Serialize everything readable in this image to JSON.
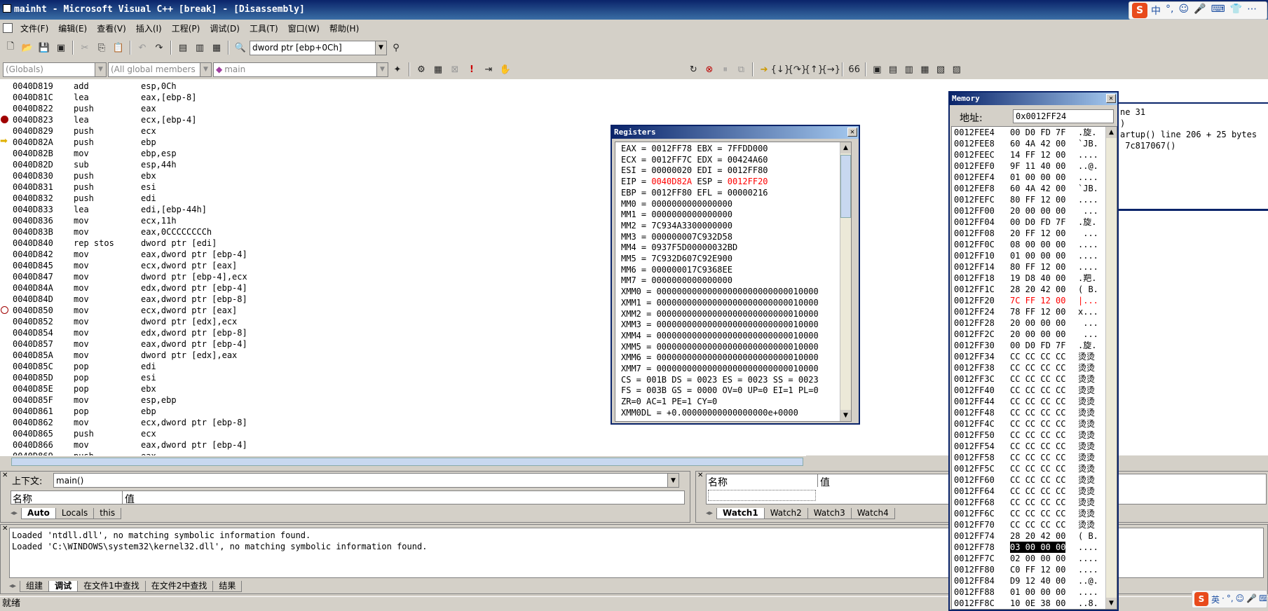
{
  "title": "mainht - Microsoft Visual C++ [break] - [Disassembly]",
  "ime_top": {
    "logo": "S",
    "items": [
      "中",
      "°,",
      "☺",
      "🎤",
      "⌨",
      "👕",
      "⋯"
    ]
  },
  "menu": [
    "文件(F)",
    "编辑(E)",
    "查看(V)",
    "插入(I)",
    "工程(P)",
    "调试(D)",
    "工具(T)",
    "窗口(W)",
    "帮助(H)"
  ],
  "find_combo": "dword ptr [ebp+0Ch]",
  "scope_combos": [
    "(Globals)",
    "(All global members",
    "main"
  ],
  "disasm": [
    {
      "addr": "0040D819",
      "op": "add",
      "arg": "esp,0Ch"
    },
    {
      "addr": "0040D81C",
      "op": "lea",
      "arg": "eax,[ebp-8]"
    },
    {
      "addr": "0040D822",
      "op": "push",
      "arg": "eax"
    },
    {
      "addr": "0040D823",
      "op": "lea",
      "arg": "ecx,[ebp-4]",
      "marker": "breakpoint"
    },
    {
      "addr": "0040D829",
      "op": "push",
      "arg": "ecx"
    },
    {
      "addr": "0040D82A",
      "op": "push",
      "arg": "ebp",
      "marker": "current"
    },
    {
      "addr": "0040D82B",
      "op": "mov",
      "arg": "ebp,esp"
    },
    {
      "addr": "0040D82D",
      "op": "sub",
      "arg": "esp,44h"
    },
    {
      "addr": "0040D830",
      "op": "push",
      "arg": "ebx"
    },
    {
      "addr": "0040D831",
      "op": "push",
      "arg": "esi"
    },
    {
      "addr": "0040D832",
      "op": "push",
      "arg": "edi"
    },
    {
      "addr": "0040D833",
      "op": "lea",
      "arg": "edi,[ebp-44h]"
    },
    {
      "addr": "0040D836",
      "op": "mov",
      "arg": "ecx,11h"
    },
    {
      "addr": "0040D83B",
      "op": "mov",
      "arg": "eax,0CCCCCCCCh"
    },
    {
      "addr": "0040D840",
      "op": "rep stos",
      "arg": "dword ptr [edi]"
    },
    {
      "addr": "0040D842",
      "op": "mov",
      "arg": "eax,dword ptr [ebp-4]"
    },
    {
      "addr": "0040D845",
      "op": "mov",
      "arg": "ecx,dword ptr [eax]"
    },
    {
      "addr": "0040D847",
      "op": "mov",
      "arg": "dword ptr [ebp-4],ecx"
    },
    {
      "addr": "0040D84A",
      "op": "mov",
      "arg": "edx,dword ptr [ebp-4]"
    },
    {
      "addr": "0040D84D",
      "op": "mov",
      "arg": "eax,dword ptr [ebp-8]"
    },
    {
      "addr": "0040D850",
      "op": "mov",
      "arg": "ecx,dword ptr [eax]",
      "marker": "disabled"
    },
    {
      "addr": "0040D852",
      "op": "mov",
      "arg": "dword ptr [edx],ecx"
    },
    {
      "addr": "0040D854",
      "op": "mov",
      "arg": "edx,dword ptr [ebp-8]"
    },
    {
      "addr": "0040D857",
      "op": "mov",
      "arg": "eax,dword ptr [ebp-4]"
    },
    {
      "addr": "0040D85A",
      "op": "mov",
      "arg": "dword ptr [edx],eax"
    },
    {
      "addr": "0040D85C",
      "op": "pop",
      "arg": "edi"
    },
    {
      "addr": "0040D85D",
      "op": "pop",
      "arg": "esi"
    },
    {
      "addr": "0040D85E",
      "op": "pop",
      "arg": "ebx"
    },
    {
      "addr": "0040D85F",
      "op": "mov",
      "arg": "esp,ebp"
    },
    {
      "addr": "0040D861",
      "op": "pop",
      "arg": "ebp"
    },
    {
      "addr": "0040D862",
      "op": "mov",
      "arg": "ecx,dword ptr [ebp-8]"
    },
    {
      "addr": "0040D865",
      "op": "push",
      "arg": "ecx"
    },
    {
      "addr": "0040D866",
      "op": "mov",
      "arg": "eax,dword ptr [ebp-4]"
    },
    {
      "addr": "0040D869",
      "op": "push",
      "arg": "eax"
    }
  ],
  "callstack_partial": [
    "ne 31",
    ")",
    "artup() line 206 + 25 bytes",
    " 7c817067()"
  ],
  "registers": {
    "title": "Registers",
    "lines": [
      {
        "text": "EAX = 0012FF78 EBX = 7FFDD000"
      },
      {
        "text": "ECX = 0012FF7C EDX = 00424A60"
      },
      {
        "text": "ESI = 00000020 EDI = 0012FF80"
      },
      {
        "parts": [
          "EIP = ",
          "0040D82A",
          " ESP = ",
          "0012FF20"
        ],
        "red": [
          1,
          3
        ]
      },
      {
        "text": "EBP = 0012FF80 EFL = 00000216"
      },
      {
        "text": "MM0 = 0000000000000000"
      },
      {
        "text": "MM1 = 0000000000000000"
      },
      {
        "text": "MM2 = 7C934A3300000000"
      },
      {
        "text": "MM3 = 000000007C932D58"
      },
      {
        "text": "MM4 = 0937F5D00000032BD"
      },
      {
        "text": "MM5 = 7C932D607C92E900"
      },
      {
        "text": "MM6 = 000000017C9368EE"
      },
      {
        "text": "MM7 = 0000000000000000"
      },
      {
        "text": "XMM0 = 00000000000000000000000000010000"
      },
      {
        "text": "XMM1 = 00000000000000000000000000010000"
      },
      {
        "text": "XMM2 = 00000000000000000000000000010000"
      },
      {
        "text": "XMM3 = 00000000000000000000000000010000"
      },
      {
        "text": "XMM4 = 00000000000000000000000000010000"
      },
      {
        "text": "XMM5 = 00000000000000000000000000010000"
      },
      {
        "text": "XMM6 = 00000000000000000000000000010000"
      },
      {
        "text": "XMM7 = 00000000000000000000000000010000"
      },
      {
        "text": "CS = 001B DS = 0023 ES = 0023 SS = 0023"
      },
      {
        "text": "FS = 003B GS = 0000 OV=0 UP=0 EI=1 PL=0"
      },
      {
        "text": "ZR=0 AC=1 PE=1 CY=0"
      },
      {
        "text": "XMM0DL = +0.00000000000000000e+0000"
      }
    ]
  },
  "memory": {
    "title": "Memory",
    "address_label": "地址:",
    "address_value": "0x0012FF24",
    "rows": [
      {
        "addr": "0012FEE4",
        "bytes": "00 D0 FD 7F",
        "ascii": ".旋."
      },
      {
        "addr": "0012FEE8",
        "bytes": "60 4A 42 00",
        "ascii": "`JB."
      },
      {
        "addr": "0012FEEC",
        "bytes": "14 FF 12 00",
        "ascii": "...."
      },
      {
        "addr": "0012FEF0",
        "bytes": "9F 11 40 00",
        "ascii": "..@."
      },
      {
        "addr": "0012FEF4",
        "bytes": "01 00 00 00",
        "ascii": "...."
      },
      {
        "addr": "0012FEF8",
        "bytes": "60 4A 42 00",
        "ascii": "`JB."
      },
      {
        "addr": "0012FEFC",
        "bytes": "80 FF 12 00",
        "ascii": "...."
      },
      {
        "addr": "0012FF00",
        "bytes": "20 00 00 00",
        "ascii": " ..."
      },
      {
        "addr": "0012FF04",
        "bytes": "00 D0 FD 7F",
        "ascii": ".旋."
      },
      {
        "addr": "0012FF08",
        "bytes": "20 FF 12 00",
        "ascii": " ..."
      },
      {
        "addr": "0012FF0C",
        "bytes": "08 00 00 00",
        "ascii": "...."
      },
      {
        "addr": "0012FF10",
        "bytes": "01 00 00 00",
        "ascii": "...."
      },
      {
        "addr": "0012FF14",
        "bytes": "80 FF 12 00",
        "ascii": "...."
      },
      {
        "addr": "0012FF18",
        "bytes": "19 D8 40 00",
        "ascii": ".羓."
      },
      {
        "addr": "0012FF1C",
        "bytes": "28 20 42 00",
        "ascii": "( B."
      },
      {
        "addr": "0012FF20",
        "bytes": "7C FF 12 00",
        "ascii": "|...",
        "red": true
      },
      {
        "addr": "0012FF24",
        "bytes": "78 FF 12 00",
        "ascii": "x..."
      },
      {
        "addr": "0012FF28",
        "bytes": "20 00 00 00",
        "ascii": " ..."
      },
      {
        "addr": "0012FF2C",
        "bytes": "20 00 00 00",
        "ascii": " ..."
      },
      {
        "addr": "0012FF30",
        "bytes": "00 D0 FD 7F",
        "ascii": ".旋."
      },
      {
        "addr": "0012FF34",
        "bytes": "CC CC CC CC",
        "ascii": "烫烫"
      },
      {
        "addr": "0012FF38",
        "bytes": "CC CC CC CC",
        "ascii": "烫烫"
      },
      {
        "addr": "0012FF3C",
        "bytes": "CC CC CC CC",
        "ascii": "烫烫"
      },
      {
        "addr": "0012FF40",
        "bytes": "CC CC CC CC",
        "ascii": "烫烫"
      },
      {
        "addr": "0012FF44",
        "bytes": "CC CC CC CC",
        "ascii": "烫烫"
      },
      {
        "addr": "0012FF48",
        "bytes": "CC CC CC CC",
        "ascii": "烫烫"
      },
      {
        "addr": "0012FF4C",
        "bytes": "CC CC CC CC",
        "ascii": "烫烫"
      },
      {
        "addr": "0012FF50",
        "bytes": "CC CC CC CC",
        "ascii": "烫烫"
      },
      {
        "addr": "0012FF54",
        "bytes": "CC CC CC CC",
        "ascii": "烫烫"
      },
      {
        "addr": "0012FF58",
        "bytes": "CC CC CC CC",
        "ascii": "烫烫"
      },
      {
        "addr": "0012FF5C",
        "bytes": "CC CC CC CC",
        "ascii": "烫烫"
      },
      {
        "addr": "0012FF60",
        "bytes": "CC CC CC CC",
        "ascii": "烫烫"
      },
      {
        "addr": "0012FF64",
        "bytes": "CC CC CC CC",
        "ascii": "烫烫"
      },
      {
        "addr": "0012FF68",
        "bytes": "CC CC CC CC",
        "ascii": "烫烫"
      },
      {
        "addr": "0012FF6C",
        "bytes": "CC CC CC CC",
        "ascii": "烫烫"
      },
      {
        "addr": "0012FF70",
        "bytes": "CC CC CC CC",
        "ascii": "烫烫"
      },
      {
        "addr": "0012FF74",
        "bytes": "28 20 42 00",
        "ascii": "( B."
      },
      {
        "addr": "0012FF78",
        "bytes": "03 00 00 00",
        "ascii": "....",
        "selected": true
      },
      {
        "addr": "0012FF7C",
        "bytes": "02 00 00 00",
        "ascii": "...."
      },
      {
        "addr": "0012FF80",
        "bytes": "C0 FF 12 00",
        "ascii": "...."
      },
      {
        "addr": "0012FF84",
        "bytes": "D9 12 40 00",
        "ascii": "..@."
      },
      {
        "addr": "0012FF88",
        "bytes": "01 00 00 00",
        "ascii": "...."
      },
      {
        "addr": "0012FF8C",
        "bytes": "10 0E 38 00",
        "ascii": "..8."
      }
    ]
  },
  "variables": {
    "context_label": "上下文:",
    "context_value": "main()",
    "col_name": "名称",
    "col_value": "值",
    "tabs": [
      "Auto",
      "Locals",
      "this"
    ]
  },
  "watch": {
    "col_name": "名称",
    "col_value": "值",
    "tabs": [
      "Watch1",
      "Watch2",
      "Watch3",
      "Watch4"
    ]
  },
  "output": {
    "lines": [
      "Loaded 'ntdll.dll', no matching symbolic information found.",
      "Loaded 'C:\\WINDOWS\\system32\\kernel32.dll', no matching symbolic information found."
    ],
    "tabs": [
      "组建",
      "调试",
      "在文件1中查找",
      "在文件2中查找",
      "结果"
    ]
  },
  "status": "就绪",
  "ime_bottom": {
    "logo": "S",
    "items": [
      "英",
      "·",
      "°,",
      "☺",
      "🎤",
      "⌨",
      "👕",
      "⋯"
    ]
  },
  "colors": {
    "title": "#0a246a",
    "accent_red": "#ff0000",
    "selection": "#000000"
  }
}
